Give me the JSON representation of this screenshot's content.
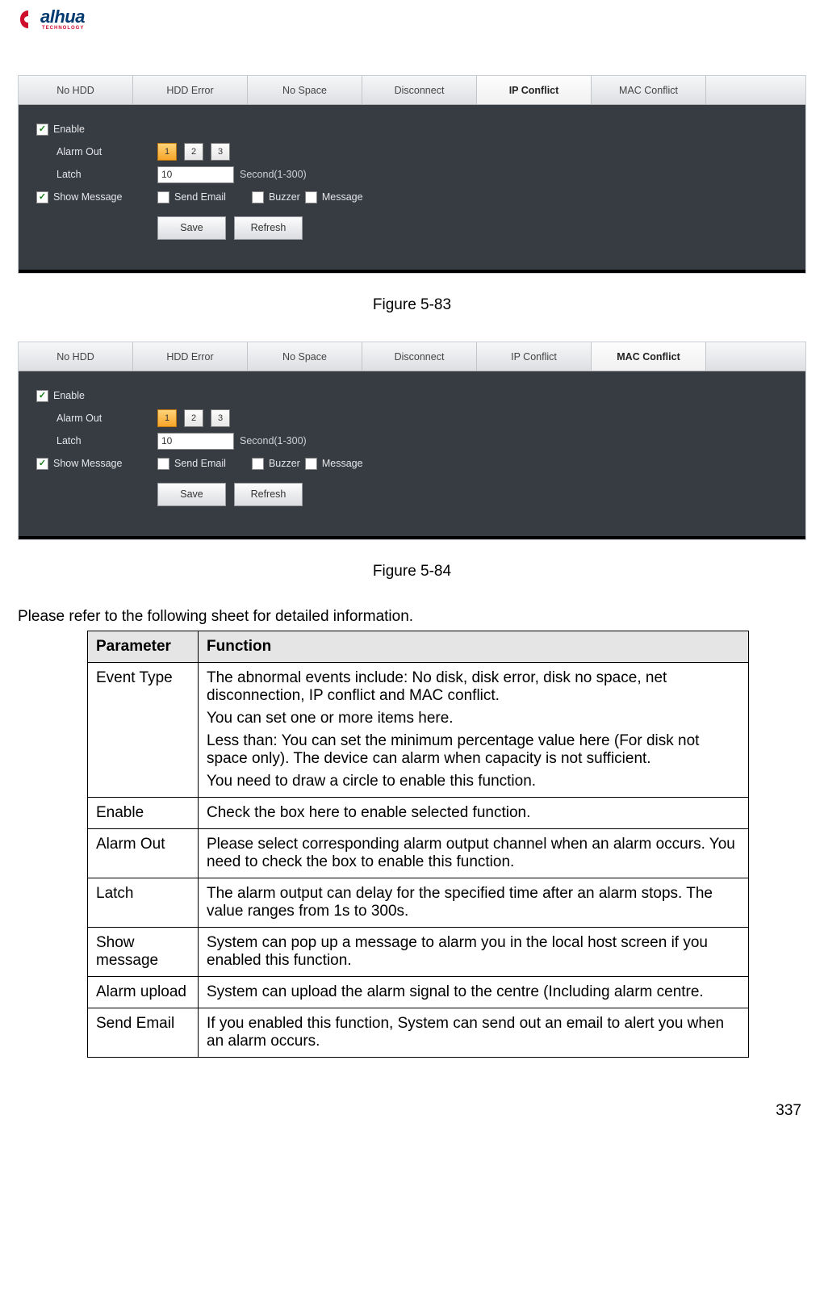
{
  "logo": {
    "main": "alhua",
    "sub": "TECHNOLOGY"
  },
  "panel1": {
    "tabs": [
      "No HDD",
      "HDD Error",
      "No Space",
      "Disconnect",
      "IP Conflict",
      "MAC Conflict"
    ],
    "active_index": 4,
    "enable_label": "Enable",
    "alarmout_label": "Alarm Out",
    "latch_label": "Latch",
    "latch_value": "10",
    "latch_hint": "Second(1-300)",
    "showmsg_label": "Show Message",
    "sendemail_label": "Send Email",
    "buzzer_label": "Buzzer",
    "message_label": "Message",
    "save_label": "Save",
    "refresh_label": "Refresh",
    "alarm_buttons": [
      "1",
      "2",
      "3"
    ]
  },
  "fig1_caption": "Figure 5-83",
  "panel2": {
    "tabs": [
      "No HDD",
      "HDD Error",
      "No Space",
      "Disconnect",
      "IP Conflict",
      "MAC Conflict"
    ],
    "active_index": 5,
    "enable_label": "Enable",
    "alarmout_label": "Alarm Out",
    "latch_label": "Latch",
    "latch_value": "10",
    "latch_hint": "Second(1-300)",
    "showmsg_label": "Show Message",
    "sendemail_label": "Send Email",
    "buzzer_label": "Buzzer",
    "message_label": "Message",
    "save_label": "Save",
    "refresh_label": "Refresh",
    "alarm_buttons": [
      "1",
      "2",
      "3"
    ]
  },
  "fig2_caption": "Figure 5-84",
  "sheet_intro": "Please refer to the following sheet for detailed information.",
  "table": {
    "h1": "Parameter",
    "h2": "Function",
    "rows": [
      {
        "p": "Event Type",
        "f": [
          "The abnormal events include: No disk, disk error, disk no space, net disconnection, IP conflict and MAC conflict.",
          "You can set one or more items here.",
          "Less than: You can set the minimum percentage value here (For disk not space only). The device can alarm when capacity is not sufficient.",
          "You need to draw a circle to enable this function."
        ]
      },
      {
        "p": "Enable",
        "f": [
          "Check the box here to enable selected function."
        ]
      },
      {
        "p": "Alarm Out",
        "f": [
          "Please select corresponding alarm output channel when an alarm occurs. You need to check the box to enable this function."
        ]
      },
      {
        "p": "Latch",
        "f": [
          "The alarm output can delay for the specified time after an alarm stops. The value ranges from 1s to 300s."
        ]
      },
      {
        "p": "Show message",
        "f": [
          "System can pop up a message to alarm you in the local host screen if you enabled this function."
        ]
      },
      {
        "p": "Alarm upload",
        "f": [
          "System can upload the alarm signal to the centre (Including alarm centre."
        ]
      },
      {
        "p": "Send Email",
        "f": [
          "If you enabled this function, System can send out an email to alert you when an alarm occurs."
        ]
      }
    ]
  },
  "page_number": "337"
}
